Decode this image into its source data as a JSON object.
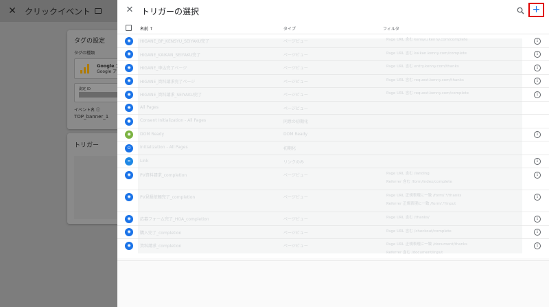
{
  "background": {
    "title": "クリックイベント",
    "tag_card": {
      "heading": "タグの設定",
      "type_label": "タグの種類",
      "tag_name": "Google ア",
      "tag_sub": "Google ア",
      "settings_label": "測定 ID",
      "event_label": "イベント名",
      "event_value": "TOP_banner_1"
    },
    "trigger_card": {
      "heading": "トリガー"
    }
  },
  "panel": {
    "title": "トリガーの選択",
    "columns": {
      "name": "名前 ↑",
      "type": "タイプ",
      "filter": "フィルタ"
    }
  },
  "rows": [
    {
      "icon": "eye-icon",
      "color": "#1a73e8",
      "name": "HIGANE_BP_KENSYU_SEIYAKU完了",
      "type": "ページビュー",
      "filter": [
        "Page URL   含む   kensyu.kenny.com/complete"
      ],
      "info": true
    },
    {
      "icon": "eye-icon",
      "color": "#1a73e8",
      "name": "HIGANE_KAIKAN_SEIYAKU完了",
      "type": "ページビュー",
      "filter": [
        "Page URL   含む   kaikan.kenny.com/complete"
      ],
      "info": true
    },
    {
      "icon": "eye-icon",
      "color": "#1a73e8",
      "name": "HIGANE_申込完了ページ",
      "type": "ページビュー",
      "filter": [
        "Page URL   含む   entry.kenny.com/thanks"
      ],
      "info": true
    },
    {
      "icon": "eye-icon",
      "color": "#1a73e8",
      "name": "HIGANE_資料請求完了ページ",
      "type": "ページビュー",
      "filter": [
        "Page URL   含む   request.kenny.com/thanks"
      ],
      "info": true
    },
    {
      "icon": "eye-icon",
      "color": "#1a73e8",
      "name": "HIGANE_資料請求_SEIYAKU完了",
      "type": "ページビュー",
      "filter": [
        "Page URL   含む   request.kenny.com/complete"
      ],
      "info": true
    },
    {
      "icon": "eye-icon",
      "color": "#1a73e8",
      "name": "All Pages",
      "type": "ページビュー",
      "filter": [],
      "info": false
    },
    {
      "icon": "consent-icon",
      "color": "#1a73e8",
      "name": "Consent Initialization - All Pages",
      "type": "同意の初期化",
      "filter": [],
      "info": false
    },
    {
      "icon": "eye-icon",
      "color": "#7cb342",
      "name": "DOM Ready",
      "type": "DOM Ready",
      "filter": [],
      "info": true
    },
    {
      "icon": "power-icon",
      "color": "#1a73e8",
      "name": "Initialization - All Pages",
      "type": "初期化",
      "filter": [],
      "info": false
    },
    {
      "icon": "link-icon",
      "color": "#1e88e5",
      "name": "Link",
      "type": "リンクのみ",
      "filter": [],
      "info": true
    },
    {
      "icon": "eye-icon",
      "color": "#1a73e8",
      "name": "PV資料請求_completion",
      "type": "ページビュー",
      "filter": [
        "Page URL   含む   /landing",
        "Referrer   含む   /form/index/complete"
      ],
      "info": true
    },
    {
      "icon": "eye-icon",
      "color": "#1a73e8",
      "name": "PV見積依頼完了_completion",
      "type": "ページビュー",
      "filter": [
        "Page URL   正規表現に一致   /form/.*/thanks",
        "Referrer   正規表現に一致   /form/.*/input"
      ],
      "info": true
    },
    {
      "icon": "eye-icon",
      "color": "#1a73e8",
      "name": "応募フォーム完了_HGA_completion",
      "type": "ページビュー",
      "filter": [
        "Page URL   含む   /thanks/"
      ],
      "info": true
    },
    {
      "icon": "eye-icon",
      "color": "#1a73e8",
      "name": "購入完了_completion",
      "type": "ページビュー",
      "filter": [
        "Page URL   含む   /checkout/complete"
      ],
      "info": true
    },
    {
      "icon": "eye-icon",
      "color": "#1a73e8",
      "name": "資料請求_completion",
      "type": "ページビュー",
      "filter": [
        "Page URL   正規表現に一致   /document/thanks",
        "Referrer   含む   /document/input"
      ],
      "info": true
    }
  ]
}
